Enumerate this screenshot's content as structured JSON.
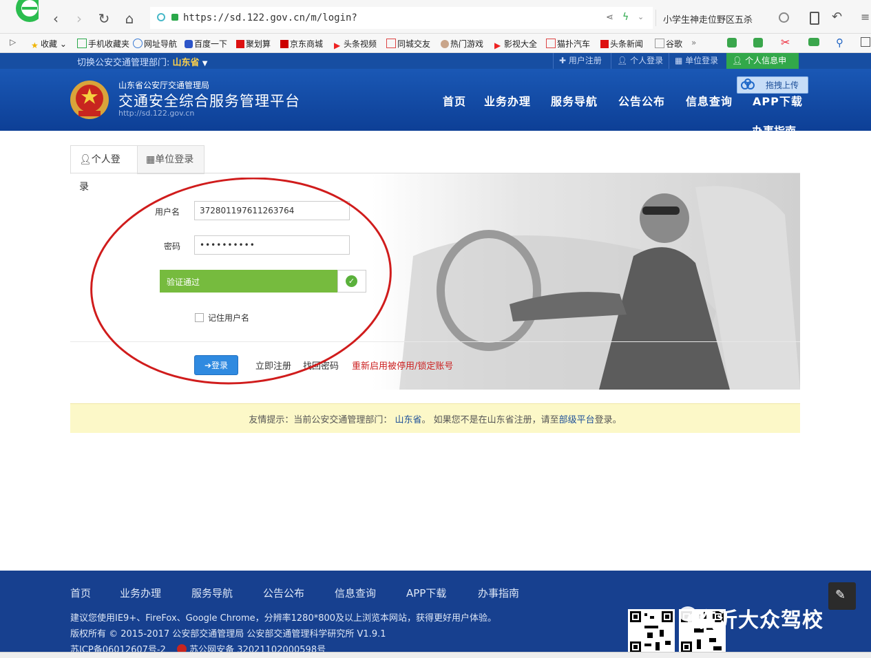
{
  "browser": {
    "url": "https://sd.122.gov.cn/m/login?",
    "search_text": "小学生神走位野区五杀",
    "bookmarks": [
      "收藏",
      "手机收藏夹",
      "网址导航",
      "百度一下",
      "聚划算",
      "京东商城",
      "头条视频",
      "同城交友",
      "热门游戏",
      "影视大全",
      "猫扑汽车",
      "头条新闻",
      "谷歌"
    ],
    "more": "»"
  },
  "site": {
    "switch_label": "切换公安交通管理部门:",
    "province": "山东省",
    "top_links": [
      "用户注册",
      "个人登录",
      "单位登录",
      "个人信息申诉"
    ],
    "org_small": "山东省公安厅交通管理局",
    "org_title": "交通安全综合服务管理平台",
    "org_url": "http://sd.122.gov.cn",
    "nav": [
      "首页",
      "业务办理",
      "服务导航",
      "公告公布",
      "信息查询",
      "APP下载"
    ],
    "nav_extra": "办事指南",
    "upload_label": "拖拽上传"
  },
  "login": {
    "tabs": [
      "个人登录",
      "单位登录"
    ],
    "username_label": "用户名",
    "username_value": "372801197611263764",
    "password_label": "密码",
    "password_value": "••••••••••",
    "verify_text": "验证通过",
    "remember_label": "记住用户名",
    "login_button": "登录",
    "register_link": "立即注册",
    "recover_link": "找回密码",
    "reactivate_link": "重新启用被停用/锁定账号"
  },
  "notice": {
    "prefix": "友情提示：当前公安交通管理部门：",
    "province": "山东省",
    "middle": "。 如果您不是在山东省注册，请至",
    "link": "部级平台",
    "suffix": "登录。"
  },
  "footer": {
    "nav": [
      "首页",
      "业务办理",
      "服务导航",
      "公告公布",
      "信息查询",
      "APP下载",
      "办事指南"
    ],
    "browser_tip": "建议您使用IE9+、FireFox、Google Chrome，分辨率1280*800及以上浏览本网站，获得更好用户体验。",
    "copyright": "版权所有 © 2015-2017 公安部交通管理局 公安部交通管理科学研究所 V1.9.1",
    "icp": "苏ICP备06012607号-2",
    "police_record": "苏公网安备 32021102000598号",
    "watermark": "临沂大众驾校"
  },
  "colors": {
    "header_blue": "#1a58b5",
    "verify_green": "#76bb3e",
    "annotation_red": "#d01c1c",
    "notice_yellow": "#fcf8c8"
  }
}
